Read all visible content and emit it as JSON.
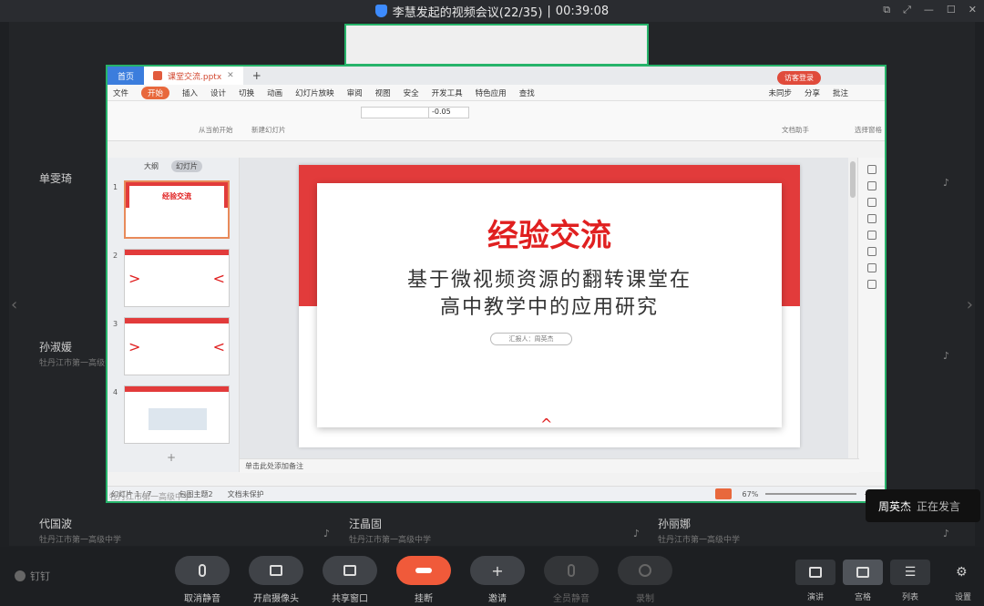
{
  "window": {
    "title": "李慧发起的视频会议(22/35)",
    "separator": "|",
    "timer": "00:39:08"
  },
  "participants": [
    {
      "name": "单雯琦",
      "org": ""
    },
    {
      "name": "孙淑媛",
      "org": "牡丹江市第一高级中学"
    },
    {
      "name": "代国波",
      "org": "牡丹江市第一高级中学"
    },
    {
      "name": "汪晶固",
      "org": "牡丹江市第一高级中学"
    },
    {
      "name": "孙丽娜",
      "org": "牡丹江市第一高级中学"
    }
  ],
  "shared_org_caption": "牡丹江市第一高级中学",
  "wps": {
    "home_tab": "首页",
    "file_tab": "课堂交流.pptx",
    "login": "访客登录",
    "menus": [
      "文件",
      "开始",
      "插入",
      "设计",
      "切换",
      "动画",
      "幻灯片放映",
      "审阅",
      "视图",
      "安全",
      "开发工具",
      "特色应用",
      "查找"
    ],
    "active_menu": "开始",
    "sync": "未同步",
    "share": "分享",
    "annotate": "批注",
    "ribbon_from_start": "从当前开始",
    "ribbon_new_slide": "新建幻灯片",
    "ribbon_doc_helper": "文档助手",
    "ribbon_select_pane": "选择窗格",
    "font_size": "-0.05",
    "pane_tab_outline": "大纲",
    "pane_tab_slides": "幻灯片",
    "thumb_numbers": [
      "1",
      "2",
      "3",
      "4"
    ],
    "thumb1_title": "经验交流",
    "notes_placeholder": "单击此处添加备注",
    "status_slide": "幻灯片 1 / 7",
    "status_theme": "包图主题2",
    "status_protect": "文档未保护",
    "zoom": "67%",
    "plus": "+"
  },
  "slide": {
    "title": "经验交流",
    "subtitle_line1": "基于微视频资源的翻转课堂在",
    "subtitle_line2": "高中教学中的应用研究",
    "reporter": "汇报人：周英杰"
  },
  "speaking": {
    "name": "周英杰",
    "state": "正在发言"
  },
  "brand": "钉钉",
  "toolbar": {
    "buttons": [
      {
        "label": "取消静音",
        "enabled": true
      },
      {
        "label": "开启摄像头",
        "enabled": true
      },
      {
        "label": "共享窗口",
        "enabled": true
      },
      {
        "label": "挂断",
        "enabled": true
      },
      {
        "label": "邀请",
        "enabled": true
      },
      {
        "label": "全员静音",
        "enabled": false
      },
      {
        "label": "录制",
        "enabled": false
      }
    ],
    "layouts": [
      {
        "label": "演讲",
        "active": false
      },
      {
        "label": "宫格",
        "active": true
      },
      {
        "label": "列表",
        "active": false
      }
    ],
    "settings": "设置"
  }
}
